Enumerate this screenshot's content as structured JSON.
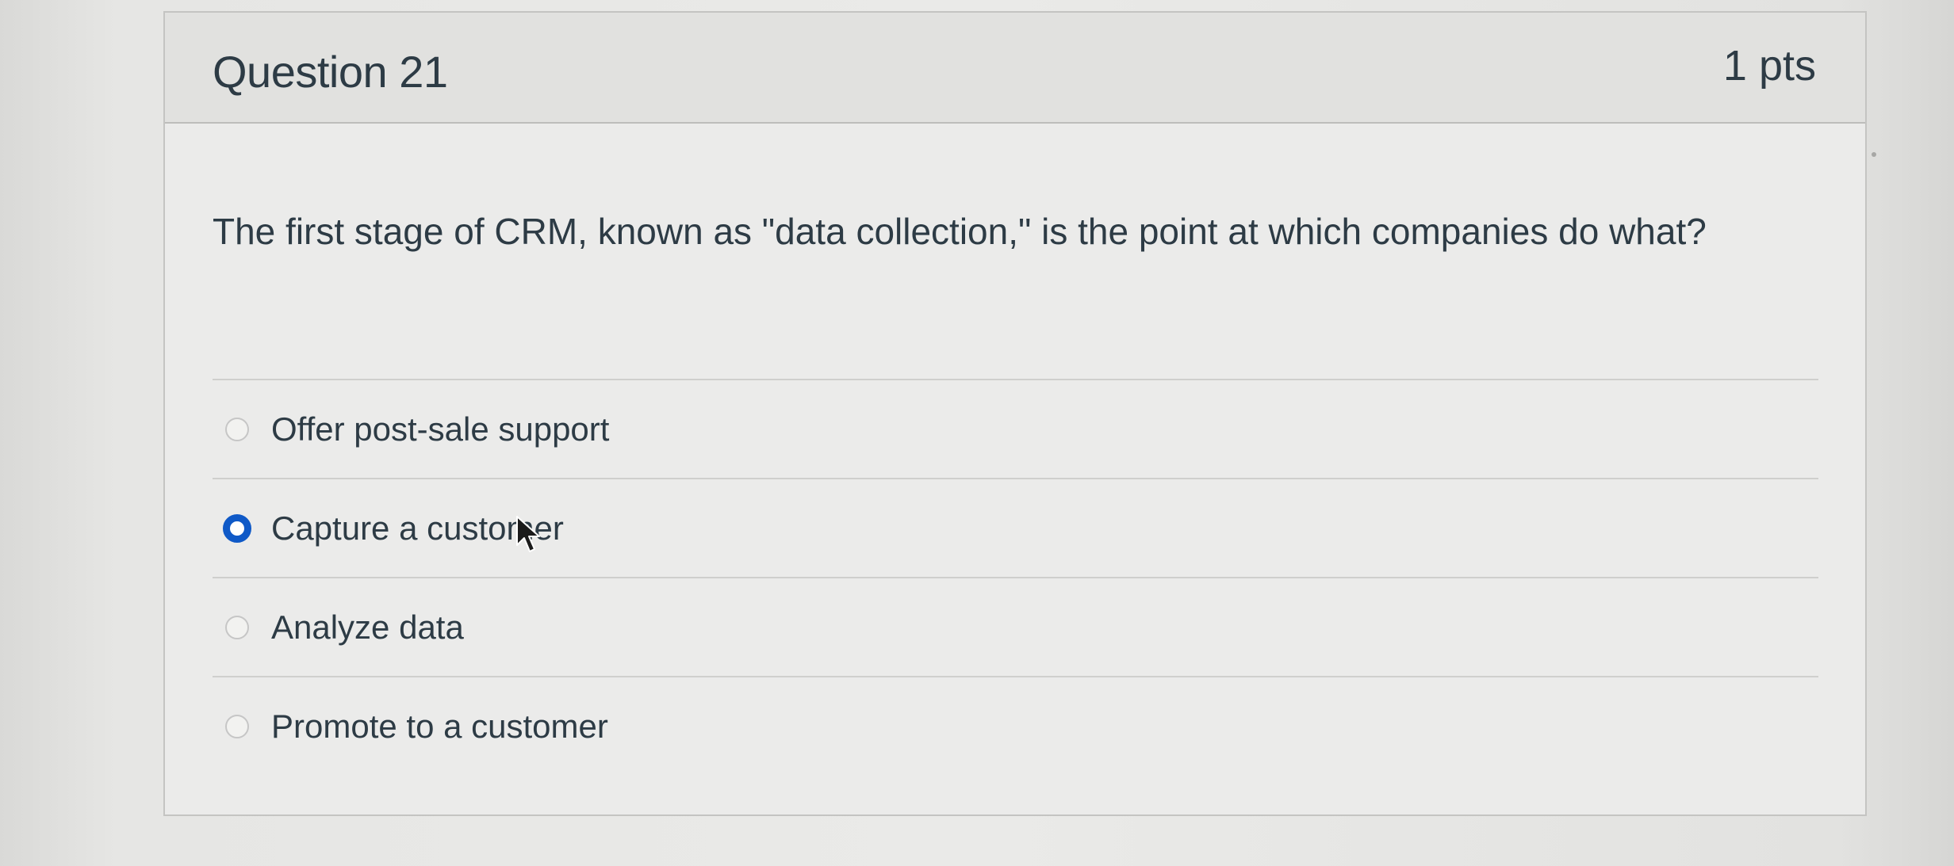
{
  "question": {
    "title": "Question 21",
    "points": "1 pts",
    "text": "The first stage of CRM, known as \"data collection,\" is the point at which companies do what?"
  },
  "answers": [
    {
      "label": "Offer post-sale support",
      "selected": false
    },
    {
      "label": "Capture a customer",
      "selected": true
    },
    {
      "label": "Analyze data",
      "selected": false
    },
    {
      "label": "Promote to a customer",
      "selected": false
    }
  ],
  "colors": {
    "text": "#2d3b45",
    "radio_selected": "#0f59c7",
    "background": "#ebebea"
  },
  "icons": {
    "cursor": "mouse-pointer-icon"
  }
}
